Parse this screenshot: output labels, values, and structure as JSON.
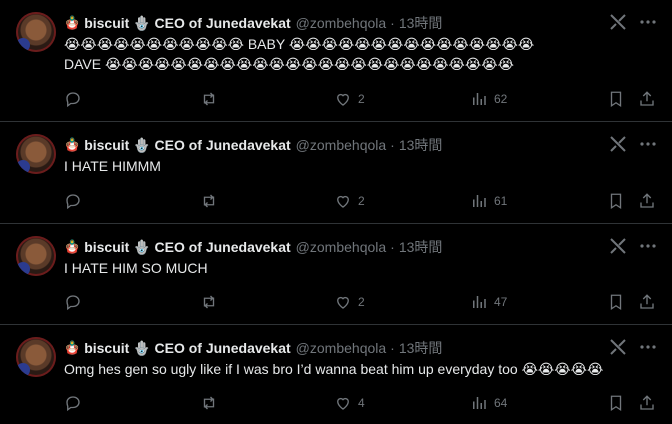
{
  "author": {
    "pre_emoji": "🪆",
    "name": "biscuit 🪬 CEO of Junedavekat",
    "handle": "@zombehqola",
    "separator": "·"
  },
  "tweets": [
    {
      "time": "13時間",
      "text": "😭😭😭😭😭😭😭😭😭😭😭 BABY 😭😭😭😭😭😭😭😭😭😭😭😭😭😭😭\nDAVE 😭😭😭😭😭😭😭😭😭😭😭😭😭😭😭😭😭😭😭😭😭😭😭😭😭",
      "reply_count": "",
      "repost_count": "",
      "like_count": "2",
      "view_count": "62"
    },
    {
      "time": "13時間",
      "text": "I HATE HIMMM",
      "reply_count": "",
      "repost_count": "",
      "like_count": "2",
      "view_count": "61"
    },
    {
      "time": "13時間",
      "text": "I HATE HIM SO MUCH",
      "reply_count": "",
      "repost_count": "",
      "like_count": "2",
      "view_count": "47"
    },
    {
      "time": "13時間",
      "text": "Omg hes gen so ugly like if I was bro I’d wanna beat him up everyday too 😭😭😭😭😭",
      "reply_count": "",
      "repost_count": "",
      "like_count": "4",
      "view_count": "64"
    }
  ],
  "icons": {
    "reply": "reply-icon",
    "repost": "repost-icon",
    "like": "heart-icon",
    "views": "views-chart-icon",
    "bookmark": "bookmark-icon",
    "share": "share-icon",
    "grok": "grok-icon",
    "more": "more-icon"
  },
  "colors": {
    "background": "#000000",
    "text": "#e7e9ea",
    "muted": "#71767b",
    "divider": "#2f3336"
  }
}
